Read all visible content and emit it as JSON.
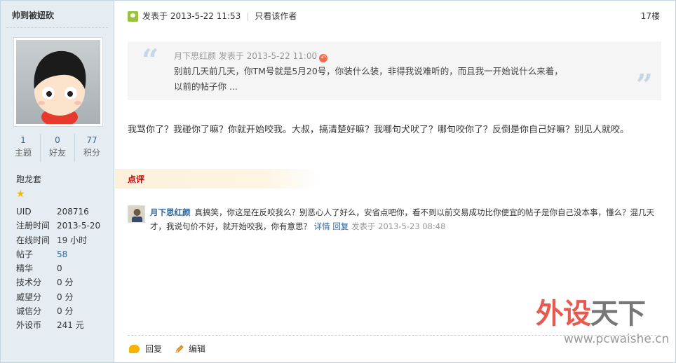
{
  "user": {
    "name": "帅到被妞砍",
    "stats": [
      {
        "value": "1",
        "label": "主题"
      },
      {
        "value": "0",
        "label": "好友"
      },
      {
        "value": "77",
        "label": "积分"
      }
    ],
    "group": "跑龙套",
    "group_icon": "star-icon",
    "info": [
      {
        "key": "UID",
        "value": "208716"
      },
      {
        "key": "注册时间",
        "value": "2013-5-20"
      },
      {
        "key": "在线时间",
        "value": "19 小时"
      },
      {
        "key": "帖子",
        "value": "58"
      },
      {
        "key": "精华",
        "value": "0"
      },
      {
        "key": "技术分",
        "value": "0 分"
      },
      {
        "key": "威望分",
        "value": "0 分"
      },
      {
        "key": "诚信分",
        "value": "0 分"
      },
      {
        "key": "外设币",
        "value": "241 元"
      }
    ]
  },
  "post": {
    "time": "发表于 2013-5-22 11:53",
    "only_author": "只看该作者",
    "floor": "17楼",
    "quote": {
      "author_time": "月下思红颜 发表于 2013-5-22 11:00",
      "line1": "别前几天前几天，你TM号就是5月20号，你装什么装，非得我说难听的，而且我一开始说什么来着，",
      "line2": "以前的帖子你 ..."
    },
    "body": "我骂你了？我碰你了嘛？你就开始咬我。大叔，搞清楚好嘛？我哪句犬吠了？哪句咬你了？反倒是你自己好嘛？别见人就咬。"
  },
  "comment_section": {
    "title": "点评",
    "author": "月下思红颜",
    "text": "真搞笑，你这是在反咬我么？别恶心人了好么，安省点吧你，看不到以前交易成功比你便宜的帖子是你自己没本事，懂么？混几天才，我说句价不好，就开始咬我，你有意思？",
    "detail_link": "详情",
    "reply_link": "回复",
    "time": "发表于 2013-5-23 08:48"
  },
  "actions": {
    "reply": "回复",
    "edit": "编辑"
  },
  "watermark": {
    "part1": "外设",
    "part2": "天下",
    "url": "www.pcwaishe.cn"
  },
  "colors": {
    "sidebar_bg": "#e5edf2",
    "link": "#336699",
    "comment_title": "#cc0000"
  }
}
